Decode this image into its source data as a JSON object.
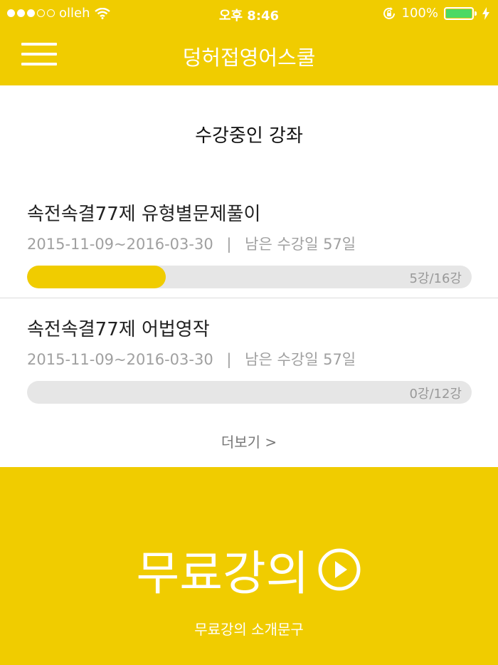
{
  "status_bar": {
    "carrier": "olleh",
    "time": "오후 8:46",
    "battery_percent": "100%",
    "battery_level": 1.0
  },
  "header": {
    "title": "덩허접영어스쿨"
  },
  "section": {
    "title": "수강중인 강좌"
  },
  "courses": [
    {
      "name": "속전속결77제 유형별문제풀이",
      "period": "2015-11-09~2016-03-30",
      "separator": "|",
      "remaining": "남은 수강일  57일",
      "progress_text": "5강/16강",
      "progress": 0.3125
    },
    {
      "name": "속전속결77제 어법영작",
      "period": "2015-11-09~2016-03-30",
      "separator": "|",
      "remaining": "남은 수강일  57일",
      "progress_text": "0강/12강",
      "progress": 0
    }
  ],
  "more_link": "더보기 >",
  "free_lecture": {
    "title": "무료강의",
    "description": "무료강의 소개문구"
  },
  "colors": {
    "accent": "#f0cc00",
    "battery": "#4cd964",
    "track": "#e6e6e6",
    "muted_text": "#a0a0a0"
  },
  "icons": [
    "wifi-icon",
    "orientation-lock-icon",
    "charging-icon",
    "hamburger-menu-icon",
    "play-circle-icon"
  ]
}
